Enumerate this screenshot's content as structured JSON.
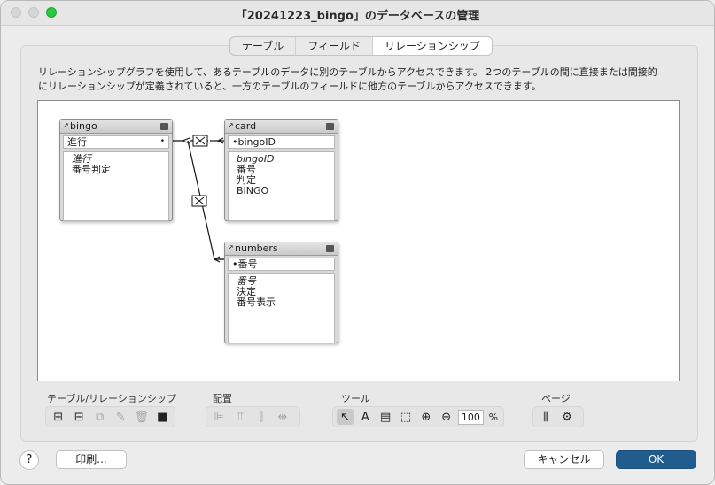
{
  "window": {
    "title": "「20241223_bingo」のデータベースの管理"
  },
  "tabs": [
    {
      "label": "テーブル"
    },
    {
      "label": "フィールド"
    },
    {
      "label": "リレーションシップ"
    }
  ],
  "description": "リレーションシップグラフを使用して、あるテーブルのデータに別のテーブルからアクセスできます。 2つのテーブルの間に直接または間接的にリレーションシップが定義されていると、一方のテーブルのフィールドに他方のテーブルからアクセスできます。",
  "tables": {
    "bingo": {
      "name": "bingo",
      "key": "進行",
      "fields": [
        "進行",
        "番号判定"
      ]
    },
    "card": {
      "name": "card",
      "key": "bingoID",
      "fields": [
        "bingoID",
        "番号",
        "判定",
        "BINGO"
      ]
    },
    "numbers": {
      "name": "numbers",
      "key": "番号",
      "fields": [
        "番号",
        "決定",
        "番号表示"
      ]
    }
  },
  "toolbar": {
    "group_tables_label": "テーブル/リレーションシップ",
    "group_arrange_label": "配置",
    "group_tools_label": "ツール",
    "group_page_label": "ページ",
    "zoom_value": "100",
    "zoom_unit": "%",
    "icons": [
      "add-table-icon",
      "add-relationship-icon",
      "duplicate-icon",
      "edit-icon",
      "trash-icon",
      "color-icon",
      "align-left-icon",
      "align-top-icon",
      "distribute-icon",
      "resize-icon",
      "pointer-icon",
      "text-icon",
      "field-icon",
      "note-icon",
      "zoom-in-icon",
      "zoom-out-icon",
      "page-break-icon",
      "page-setup-icon"
    ]
  },
  "buttons": {
    "help": "?",
    "print": "印刷...",
    "cancel": "キャンセル",
    "ok": "OK"
  },
  "colors": {
    "ok_button": "#215c8f",
    "max_button": "#2ac840"
  }
}
